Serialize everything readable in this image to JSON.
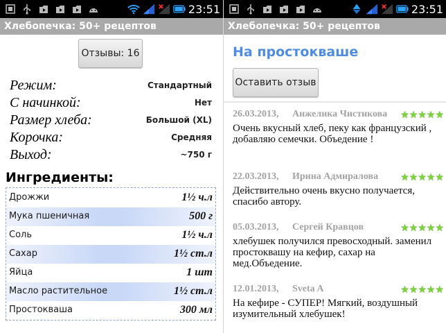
{
  "app_title": "Хлебопечка: 50+ рецептов",
  "status_bar": {
    "time": "23:51"
  },
  "left": {
    "reviews_button_label": "Отзывы: 16",
    "params": [
      {
        "label": "Режим:",
        "value": "Стандартный"
      },
      {
        "label": "С начинкой:",
        "value": "Нет"
      },
      {
        "label": "Размер хлеба:",
        "value": "Большой (XL)"
      },
      {
        "label": "Корочка:",
        "value": "Средняя"
      },
      {
        "label": "Выход:",
        "value": "~750 г"
      }
    ],
    "ingredients_title": "Ингредиенты:",
    "ingredients": [
      {
        "name": "Дрожжи",
        "qty": "1½ ч.л"
      },
      {
        "name": "Мука пшеничная",
        "qty": "500 г"
      },
      {
        "name": "Соль",
        "qty": "1½ ч.л"
      },
      {
        "name": "Сахар",
        "qty": "1½ ст.л"
      },
      {
        "name": "Яйца",
        "qty": "1 шт"
      },
      {
        "name": "Масло растительное",
        "qty": "1½ ст.л"
      },
      {
        "name": "Простокваша",
        "qty": "300 мл"
      }
    ]
  },
  "right": {
    "section_title": "На простокваше",
    "leave_review_label": "Оставить отзыв",
    "reviews": [
      {
        "date": "26.03.2013,",
        "author": "Анжелика Чистикова",
        "rating": 5,
        "text": "Очень вкусный  хлеб, пеку  как французский , добавляю семечки. Объедение !"
      },
      {
        "date": "22.03.2013,",
        "author": "Ирина Адмиралова",
        "rating": 5,
        "text": "Действительно очень вкусно получается, спасибо автору."
      },
      {
        "date": "05.03.2013,",
        "author": "Сергей Кравцов",
        "rating": 5,
        "text": "хлебушек получился превосходный. заменил простоквашу на кефир, сахар на мед.Объедение."
      },
      {
        "date": "12.01.2013,",
        "author": "Sveta A",
        "rating": 5,
        "text": "На кефире - СУПЕР! Мягкий, воздушный изумительный хлебушек!"
      }
    ]
  },
  "colors": {
    "accent": "#4f8ce0",
    "title_bar": "#a9a9a9",
    "star": "#7cd33a",
    "status_bar": "#000000"
  }
}
